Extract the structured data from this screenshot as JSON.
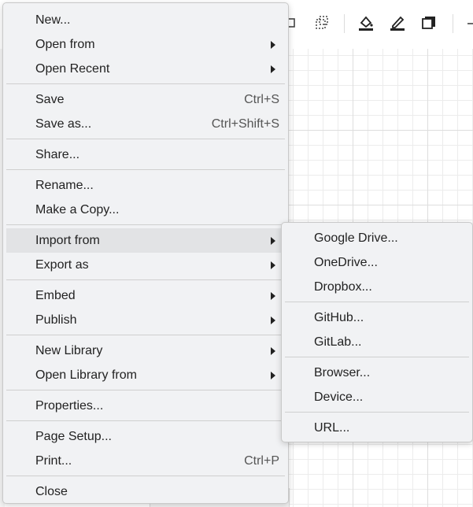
{
  "file_menu": {
    "groups": [
      [
        {
          "label": "New...",
          "shortcut": "",
          "submenu": false
        },
        {
          "label": "Open from",
          "shortcut": "",
          "submenu": true
        },
        {
          "label": "Open Recent",
          "shortcut": "",
          "submenu": true
        }
      ],
      [
        {
          "label": "Save",
          "shortcut": "Ctrl+S",
          "submenu": false
        },
        {
          "label": "Save as...",
          "shortcut": "Ctrl+Shift+S",
          "submenu": false
        }
      ],
      [
        {
          "label": "Share...",
          "shortcut": "",
          "submenu": false
        }
      ],
      [
        {
          "label": "Rename...",
          "shortcut": "",
          "submenu": false
        },
        {
          "label": "Make a Copy...",
          "shortcut": "",
          "submenu": false
        }
      ],
      [
        {
          "label": "Import from",
          "shortcut": "",
          "submenu": true,
          "active": true
        },
        {
          "label": "Export as",
          "shortcut": "",
          "submenu": true
        }
      ],
      [
        {
          "label": "Embed",
          "shortcut": "",
          "submenu": true
        },
        {
          "label": "Publish",
          "shortcut": "",
          "submenu": true
        }
      ],
      [
        {
          "label": "New Library",
          "shortcut": "",
          "submenu": true
        },
        {
          "label": "Open Library from",
          "shortcut": "",
          "submenu": true
        }
      ],
      [
        {
          "label": "Properties...",
          "shortcut": "",
          "submenu": false
        }
      ],
      [
        {
          "label": "Page Setup...",
          "shortcut": "",
          "submenu": false
        },
        {
          "label": "Print...",
          "shortcut": "Ctrl+P",
          "submenu": false
        }
      ],
      [
        {
          "label": "Close",
          "shortcut": "",
          "submenu": false
        }
      ]
    ]
  },
  "import_submenu": {
    "groups": [
      [
        "Google Drive...",
        "OneDrive...",
        "Dropbox..."
      ],
      [
        "GitHub...",
        "GitLab..."
      ],
      [
        "Browser...",
        "Device..."
      ],
      [
        "URL..."
      ]
    ]
  },
  "toolbar": {
    "icons": [
      "duplicate-icon",
      "select-region-icon",
      "fill-color-icon",
      "line-color-icon",
      "shadow-icon",
      "more-icon"
    ]
  },
  "colors": {
    "menu_bg": "#f1f2f4",
    "active_item_bg": "#e2e3e5",
    "text": "#222222",
    "shortcut_text": "#555555"
  }
}
